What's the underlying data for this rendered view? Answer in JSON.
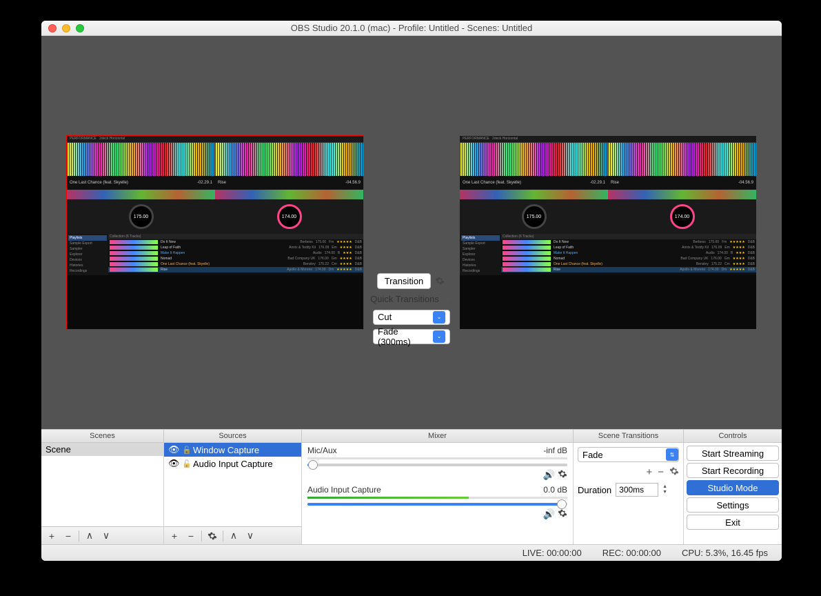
{
  "window": {
    "title": "OBS Studio 20.1.0 (mac) - Profile: Untitled - Scenes: Untitled"
  },
  "preview": {
    "track_left": {
      "title": "One Last Chance (feat. Skyelle)",
      "artist": "Bensley",
      "time": "-02.29.1",
      "bpm": "175.00"
    },
    "track_right": {
      "title": "Rise",
      "artist": "Apollo & Moreno",
      "time": "-04.56.9",
      "bpm": "174.00"
    },
    "jog_left": "175.00",
    "jog_right": "174.00",
    "browser_header": "Collection (6 Tracks)",
    "sidebar": [
      "Playlists",
      "Sample Export",
      "Sampler",
      "Explorer",
      "Devices",
      "Histories",
      "Recordings"
    ],
    "tracks": [
      {
        "title": "Do It Now",
        "artist": "Berbess",
        "bpm": "175.00",
        "key": "Fm",
        "rating": "★★★★★",
        "genre": "D&B"
      },
      {
        "title": "Leap of Faith",
        "artist": "Annix & Teddy Kil",
        "bpm": "176.09",
        "key": "Em",
        "rating": "★★★★",
        "genre": "D&B"
      },
      {
        "title": "Make It Happen",
        "artist": "Audio",
        "bpm": "174.00",
        "key": "B",
        "rating": "★★★",
        "genre": "D&B"
      },
      {
        "title": "Nomad",
        "artist": "Bad Company UK",
        "bpm": "176.00",
        "key": "Gm",
        "rating": "★★★★",
        "genre": "D&B"
      },
      {
        "title": "One Last Chance (feat. Skyelle)",
        "artist": "Bensley",
        "bpm": "175.22",
        "key": "Cm",
        "rating": "★★★★",
        "genre": "D&B"
      },
      {
        "title": "Rise",
        "artist": "Apollo & Moreno",
        "bpm": "174.00",
        "key": "Dm",
        "rating": "★★★★★",
        "genre": "D&B"
      }
    ]
  },
  "center": {
    "transition_btn": "Transition",
    "quick_label": "Quick Transitions",
    "options": [
      "Cut",
      "Fade (300ms)"
    ]
  },
  "headers": {
    "scenes": "Scenes",
    "sources": "Sources",
    "mixer": "Mixer",
    "st": "Scene Transitions",
    "ctrl": "Controls"
  },
  "scenes": {
    "items": [
      "Scene"
    ]
  },
  "sources": {
    "items": [
      {
        "label": "Window Capture",
        "selected": true
      },
      {
        "label": "Audio Input Capture",
        "selected": false
      }
    ]
  },
  "mixer": {
    "channels": [
      {
        "name": "Mic/Aux",
        "level": "-inf dB",
        "meter_pct": 0,
        "slider_pct": 2
      },
      {
        "name": "Audio Input Capture",
        "level": "0.0 dB",
        "meter_pct": 62,
        "slider_pct": 98
      }
    ]
  },
  "scene_transitions": {
    "selected": "Fade",
    "duration_label": "Duration",
    "duration_value": "300ms"
  },
  "controls": {
    "buttons": [
      "Start Streaming",
      "Start Recording",
      "Studio Mode",
      "Settings",
      "Exit"
    ],
    "active_index": 2
  },
  "status": {
    "live": "LIVE: 00:00:00",
    "rec": "REC: 00:00:00",
    "cpu": "CPU: 5.3%, 16.45 fps"
  }
}
